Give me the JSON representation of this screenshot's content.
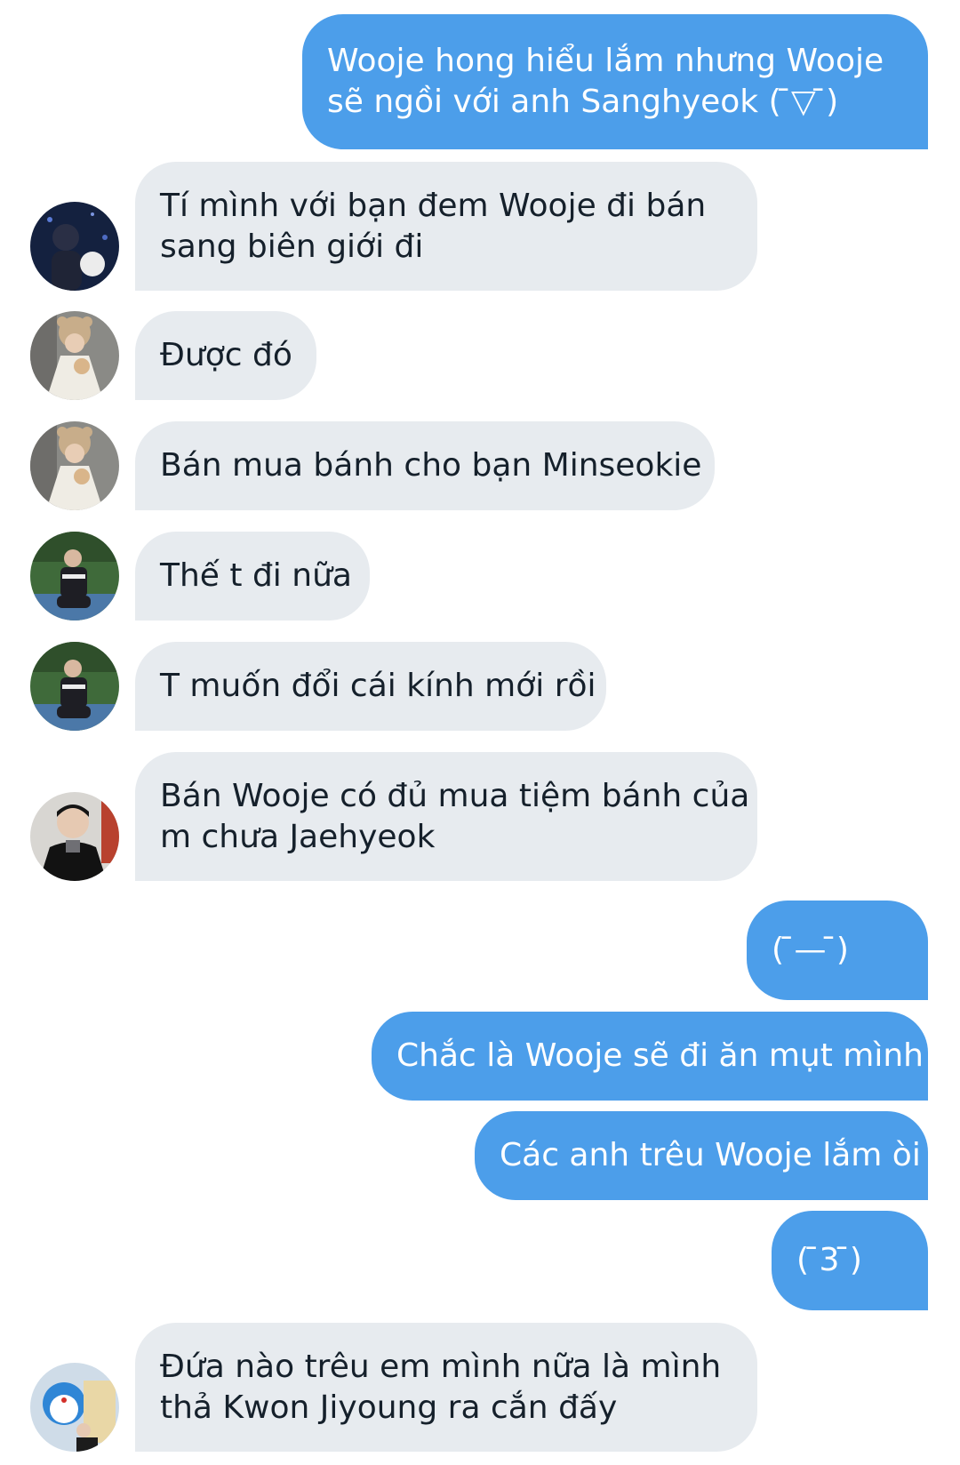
{
  "messages": [
    {
      "side": "sent",
      "lines": [
        "Wooje hong hiểu lắm nhưng Wooje",
        "sẽ ngồi với anh Sanghyeok ( ̄▽ ̄)"
      ]
    },
    {
      "side": "received",
      "avatar": "avatar-night-photo",
      "lines": [
        "Tí mình với bạn đem Wooje đi bán",
        "sang biên giới đi"
      ]
    },
    {
      "side": "received",
      "avatar": "avatar-bear-hat-photo",
      "lines": [
        "Được đó"
      ]
    },
    {
      "side": "received",
      "avatar": "avatar-bear-hat-photo",
      "lines": [
        "Bán mua bánh cho bạn Minseokie"
      ]
    },
    {
      "side": "received",
      "avatar": "avatar-park-photo",
      "lines": [
        "Thế t đi nữa"
      ]
    },
    {
      "side": "received",
      "avatar": "avatar-park-photo",
      "lines": [
        "T muốn đổi cái kính mới rồi"
      ]
    },
    {
      "side": "received",
      "avatar": "avatar-coat-photo",
      "lines": [
        "Bán Wooje có đủ mua tiệm bánh của",
        "m chưa Jaehyeok"
      ]
    },
    {
      "side": "sent",
      "lines": [
        "( ̄— ̄)"
      ]
    },
    {
      "side": "sent",
      "lines": [
        "Chắc là Wooje sẽ đi ăn mụt mình"
      ]
    },
    {
      "side": "sent",
      "lines": [
        "Các anh trêu Wooje lắm òi"
      ]
    },
    {
      "side": "sent",
      "lines": [
        "( ̄3 ̄)"
      ]
    },
    {
      "side": "received",
      "avatar": "avatar-doraemon-photo",
      "lines": [
        "Đứa nào trêu em mình nữa là mình",
        "thả Kwon Jiyoung ra cắn đấy"
      ]
    }
  ],
  "colors": {
    "sent_bubble": "#4c9eea",
    "received_bubble": "#e7ebef",
    "sent_text": "#ffffff",
    "received_text": "#15202b"
  }
}
